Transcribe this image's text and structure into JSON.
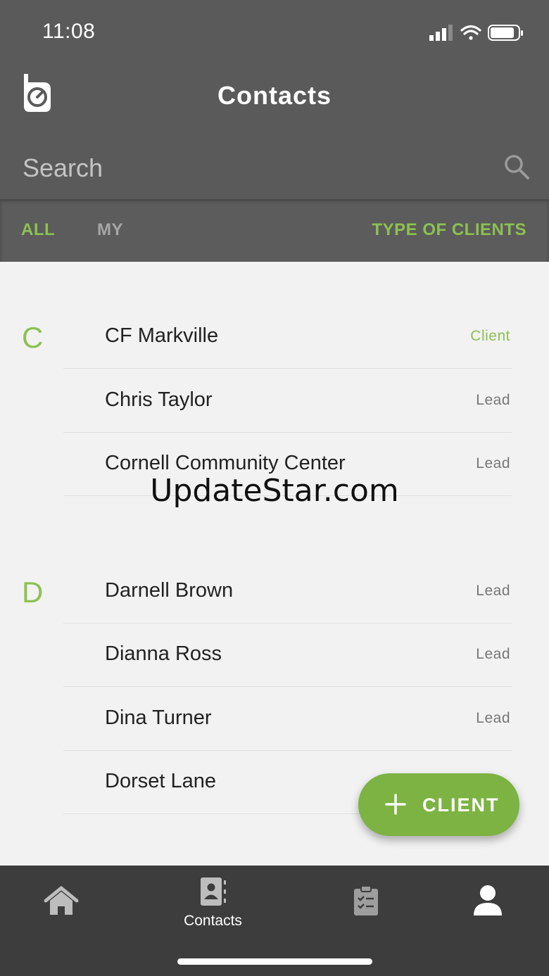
{
  "status_bar": {
    "time": "11:08"
  },
  "header": {
    "title": "Contacts"
  },
  "search": {
    "placeholder": "Search"
  },
  "tabs": {
    "all": "ALL",
    "my": "MY",
    "type_filter": "TYPE OF CLIENTS"
  },
  "sections": [
    {
      "letter": "C",
      "contacts": [
        {
          "name": "CF Markville",
          "type": "Client"
        },
        {
          "name": "Chris Taylor",
          "type": "Lead"
        },
        {
          "name": "Cornell Community Center",
          "type": "Lead"
        }
      ]
    },
    {
      "letter": "D",
      "contacts": [
        {
          "name": "Darnell Brown",
          "type": "Lead"
        },
        {
          "name": "Dianna Ross",
          "type": "Lead"
        },
        {
          "name": "Dina Turner",
          "type": "Lead"
        },
        {
          "name": "Dorset Lane",
          "type": ""
        }
      ]
    }
  ],
  "watermark": "UpdateStar.com",
  "fab": {
    "label": "CLIENT"
  },
  "bottom_nav": {
    "contacts_label": "Contacts"
  },
  "colors": {
    "accent": "#8cc152",
    "header_bg": "#5a5a5a",
    "nav_bg": "#3d3d3d",
    "fab_bg": "#7cb342"
  }
}
